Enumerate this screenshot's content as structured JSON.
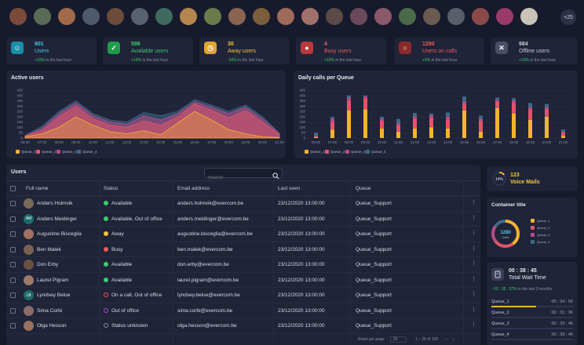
{
  "avatars": [
    {
      "initials": "",
      "bg": "#7b4a3a",
      "status": "#3ecb6a"
    },
    {
      "initials": "",
      "bg": "#5a6b55",
      "status": "#3ecb6a"
    },
    {
      "initials": "",
      "bg": "#a06a4a",
      "status": "#3ecb6a"
    },
    {
      "initials": "",
      "bg": "#4e5a6c",
      "status": "#3ecb6a"
    },
    {
      "initials": "",
      "bg": "#6b4c3a",
      "status": "#3ecb6a"
    },
    {
      "initials": "",
      "bg": "#59616e",
      "status": "#3ecb6a"
    },
    {
      "initials": "",
      "bg": "#3f6a5f",
      "status": "#3ecb6a"
    },
    {
      "initials": "",
      "bg": "#b58550",
      "status": "#3ecb6a"
    },
    {
      "initials": "",
      "bg": "#6c7a4a",
      "status": "#3ecb6a"
    },
    {
      "initials": "",
      "bg": "#8a6450",
      "status": "#3ecb6a"
    },
    {
      "initials": "",
      "bg": "#7a5e3c",
      "status": "#3ecb6a"
    },
    {
      "initials": "",
      "bg": "#9e6a5a",
      "status": "#ef4b4b"
    },
    {
      "initials": "",
      "bg": "#a0706a",
      "status": "#ef4b4b"
    },
    {
      "initials": "",
      "bg": "#5c4a48",
      "status": "#ef4b4b"
    },
    {
      "initials": "",
      "bg": "#6a4a5a",
      "status": "#ef4b4b"
    },
    {
      "initials": "",
      "bg": "#8a5a6a",
      "status": "#ef4b4b"
    },
    {
      "initials": "",
      "bg": "#4a6a4a",
      "status": "#ef4b4b"
    },
    {
      "initials": "",
      "bg": "#6a5a50",
      "status": "#ef4b4b"
    },
    {
      "initials": "",
      "bg": "#5a5e68",
      "status": "#8a90a8"
    },
    {
      "initials": "",
      "bg": "#8a4a4a",
      "status": "#8a90a8"
    },
    {
      "initials": "",
      "bg": "#9a3a6a",
      "status": "#8a90a8"
    },
    {
      "initials": "",
      "bg": "#c8c2b8",
      "status": "#8a90a8"
    }
  ],
  "more_label": "+25",
  "stats": [
    {
      "value": "601",
      "label": "Users",
      "icon": "user-icon",
      "icon_bg": "#1b8fa8",
      "label_color": "#4ec9e6",
      "sub_delta": "+10%",
      "sub_text": "in the last hour"
    },
    {
      "value": "598",
      "label": "Available users",
      "icon": "check-icon",
      "icon_bg": "#1f9c4a",
      "label_color": "#3ecb6a",
      "sub_delta": "+10%",
      "sub_text": "in the last hour"
    },
    {
      "value": "30",
      "label": "Away users",
      "icon": "clock-icon",
      "icon_bg": "#e0a52a",
      "label_color": "#f5c542",
      "sub_delta": "-10%",
      "sub_text": "in the last hour"
    },
    {
      "value": "4",
      "label": "Busy users",
      "icon": "busy-dot-icon",
      "icon_bg": "#b83a3a",
      "label_color": "#ef5b5b",
      "sub_delta": "+10%",
      "sub_text": "in the last hour"
    },
    {
      "value": "1280",
      "label": "Users on calls",
      "icon": "ring-icon",
      "icon_bg": "#8a2a2a",
      "label_color": "#ef5b5b",
      "sub_delta": "+3%",
      "sub_text": "in the last hour"
    },
    {
      "value": "984",
      "label": "Offline users",
      "icon": "close-circle-icon",
      "icon_bg": "#4a4f66",
      "label_color": "#c5c9d8",
      "sub_delta": "+10%",
      "sub_text": "in the last hour"
    }
  ],
  "active_users": {
    "title": "Active users"
  },
  "daily_calls": {
    "title": "Daily calls per Queue"
  },
  "chart_data": [
    {
      "type": "area",
      "title": "Active users",
      "x": [
        "08:00",
        "07:00",
        "08:00",
        "09:00",
        "10:00",
        "11:00",
        "12:00",
        "13:00",
        "14:00",
        "15:00",
        "16:00",
        "17:00",
        "18:00",
        "19:00",
        "20:00",
        "21:00"
      ],
      "ylim": [
        0,
        450
      ],
      "yticks": [
        "0",
        "50",
        "100",
        "150",
        "200",
        "250",
        "300",
        "350",
        "400",
        "450"
      ],
      "series": [
        {
          "name": "Queue_1",
          "color": "#f5b233",
          "values": [
            10,
            40,
            100,
            200,
            120,
            60,
            40,
            70,
            30,
            140,
            250,
            170,
            80,
            40,
            10,
            5
          ]
        },
        {
          "name": "Queue_2",
          "color": "#e0556a",
          "values": [
            15,
            70,
            200,
            300,
            180,
            120,
            100,
            160,
            120,
            200,
            320,
            260,
            190,
            260,
            150,
            30
          ]
        },
        {
          "name": "Queue_3",
          "color": "#b44c8a",
          "values": [
            20,
            90,
            230,
            330,
            210,
            150,
            130,
            210,
            170,
            230,
            340,
            290,
            230,
            290,
            180,
            40
          ]
        },
        {
          "name": "Queue_4",
          "color": "#3c6a86",
          "values": [
            25,
            110,
            250,
            350,
            230,
            170,
            150,
            240,
            210,
            250,
            360,
            310,
            250,
            310,
            200,
            45
          ]
        }
      ]
    },
    {
      "type": "bar",
      "title": "Daily calls per Queue",
      "categories": [
        "08:00",
        "07:00",
        "08:00",
        "09:00",
        "10:00",
        "11:00",
        "12:00",
        "13:00",
        "14:00",
        "15:00",
        "16:00",
        "17:00",
        "18:00",
        "19:00",
        "20:00",
        "21:00"
      ],
      "ylim": [
        0,
        450
      ],
      "yticks": [
        "0",
        "50",
        "100",
        "150",
        "200",
        "250",
        "300",
        "350",
        "400",
        "450"
      ],
      "series": [
        {
          "name": "Queue_1",
          "color": "#f5b233",
          "values": [
            10,
            80,
            260,
            270,
            90,
            60,
            90,
            100,
            90,
            260,
            60,
            280,
            230,
            170,
            200,
            20
          ]
        },
        {
          "name": "Queue_2",
          "color": "#e0556a",
          "values": [
            5,
            70,
            90,
            100,
            70,
            60,
            90,
            90,
            80,
            60,
            100,
            60,
            100,
            100,
            70,
            30
          ]
        },
        {
          "name": "Queue_3",
          "color": "#b44c8a",
          "values": [
            5,
            30,
            30,
            20,
            20,
            20,
            25,
            20,
            30,
            25,
            20,
            20,
            25,
            20,
            20,
            10
          ]
        },
        {
          "name": "Queue_4",
          "color": "#3c6a86",
          "values": [
            30,
            20,
            20,
            10,
            20,
            40,
            30,
            20,
            40,
            45,
            30,
            20,
            20,
            40,
            30,
            20
          ]
        }
      ]
    },
    {
      "type": "pie",
      "title": "Container title",
      "center_value": "1280",
      "center_label": "Calls",
      "series": [
        {
          "name": "Queue_1",
          "color": "#f5b233",
          "value": 40
        },
        {
          "name": "Queue_2",
          "color": "#e0556a",
          "value": 25
        },
        {
          "name": "Queue_3",
          "color": "#b44c8a",
          "value": 20
        },
        {
          "name": "Queue_4",
          "color": "#3c6a86",
          "value": 15
        }
      ]
    }
  ],
  "users_table": {
    "title": "Users",
    "search_placeholder": "Search",
    "columns": [
      "Full name",
      "Status",
      "Email address",
      "Last seen",
      "Queue"
    ],
    "rows": [
      {
        "name": "Anders Holmvik",
        "initials": "",
        "av_bg": "#7a6a5a",
        "status": "Available",
        "status_color": "#3ecb6a",
        "status_icon": "check-icon",
        "email": "anders.holmvik@evercom.be",
        "last_seen": "23/12/2020 13:00:00",
        "queue": "Queue_Support"
      },
      {
        "name": "Anders Meidinger",
        "initials": "AM",
        "av_bg": "#1e6a6a",
        "status": "Available, Out of office",
        "status_color": "#3ecb6a",
        "status_icon": "check-icon",
        "email": "anders.meidinger@evercom.be",
        "last_seen": "23/12/2020 13:00:00",
        "queue": "Queue_Support"
      },
      {
        "name": "Augustine Bisceglia",
        "initials": "",
        "av_bg": "#a07060",
        "status": "Away",
        "status_color": "#f5c542",
        "status_icon": "clock-icon",
        "email": "augustine.bisceglia@evercom.be",
        "last_seen": "23/12/2020 13:00:00",
        "queue": "Queue_Support"
      },
      {
        "name": "Ben Malek",
        "initials": "",
        "av_bg": "#7a6050",
        "status": "Busy",
        "status_color": "#ef5b5b",
        "status_icon": "busy-dot-icon",
        "email": "ben.malek@evercom.be",
        "last_seen": "23/12/2020 13:00:00",
        "queue": "Queue_Support"
      },
      {
        "name": "Don Erby",
        "initials": "",
        "av_bg": "#6a5040",
        "status": "Available",
        "status_color": "#3ecb6a",
        "status_icon": "check-icon",
        "email": "don.erby@evercom.be",
        "last_seen": "23/12/2020 13:00:00",
        "queue": "Queue_Support"
      },
      {
        "name": "Laurel Pigram",
        "initials": "",
        "av_bg": "#9a7a6a",
        "status": "Available",
        "status_color": "#3ecb6a",
        "status_icon": "check-icon",
        "email": "laurel.pigram@evercom.be",
        "last_seen": "23/12/2020 13:00:00",
        "queue": "Queue_Support"
      },
      {
        "name": "Lyndsey Belue",
        "initials": "LB",
        "av_bg": "#1e6a6a",
        "status": "On a call, Out of office",
        "status_color": "#ef5b5b",
        "status_icon": "ring-icon",
        "email": "lyndsey.belue@evercom.be",
        "last_seen": "23/12/2020 13:00:00",
        "queue": "Queue_Support"
      },
      {
        "name": "Sima Corbi",
        "initials": "",
        "av_bg": "#8a6a6a",
        "status": "Out of office",
        "status_color": "#b44cc8",
        "status_icon": "out-of-office-icon",
        "email": "sima.corbi@evercom.be",
        "last_seen": "23/12/2020 13:00:00",
        "queue": "Queue_Support"
      },
      {
        "name": "Olga Hesson",
        "initials": "",
        "av_bg": "#9a7060",
        "status": "Status unknown",
        "status_color": "#8a90a8",
        "status_icon": "unknown-icon",
        "email": "olga.hesson@evercom.be",
        "last_seen": "23/12/2020 13:00:00",
        "queue": "Queue_Support"
      }
    ],
    "footer": {
      "rows_per_page_label": "Rows per page",
      "rows_per_page": "25",
      "range": "1 – 25 of 100"
    }
  },
  "voicemail": {
    "percent": "14%",
    "value": "123",
    "label": "Voice Mails",
    "fill": 0.14
  },
  "container": {
    "title": "Container title"
  },
  "wait_time": {
    "value": "00 : 38 : 45",
    "label": "Total Wait Time",
    "sub_delta": "- 00 : 35 : 37%",
    "sub_text": "in the last 3 months",
    "queues": [
      {
        "name": "Queue_1",
        "time": "00 : 34 : 56",
        "fill": 0.55
      },
      {
        "name": "Queue_2",
        "time": "00 : 31 : 36",
        "fill": 0.0
      },
      {
        "name": "Queue_3",
        "time": "00 : 33 : 48",
        "fill": 0.0
      },
      {
        "name": "Queue_4",
        "time": "00 : 38 : 45",
        "fill": 0.0
      }
    ]
  }
}
